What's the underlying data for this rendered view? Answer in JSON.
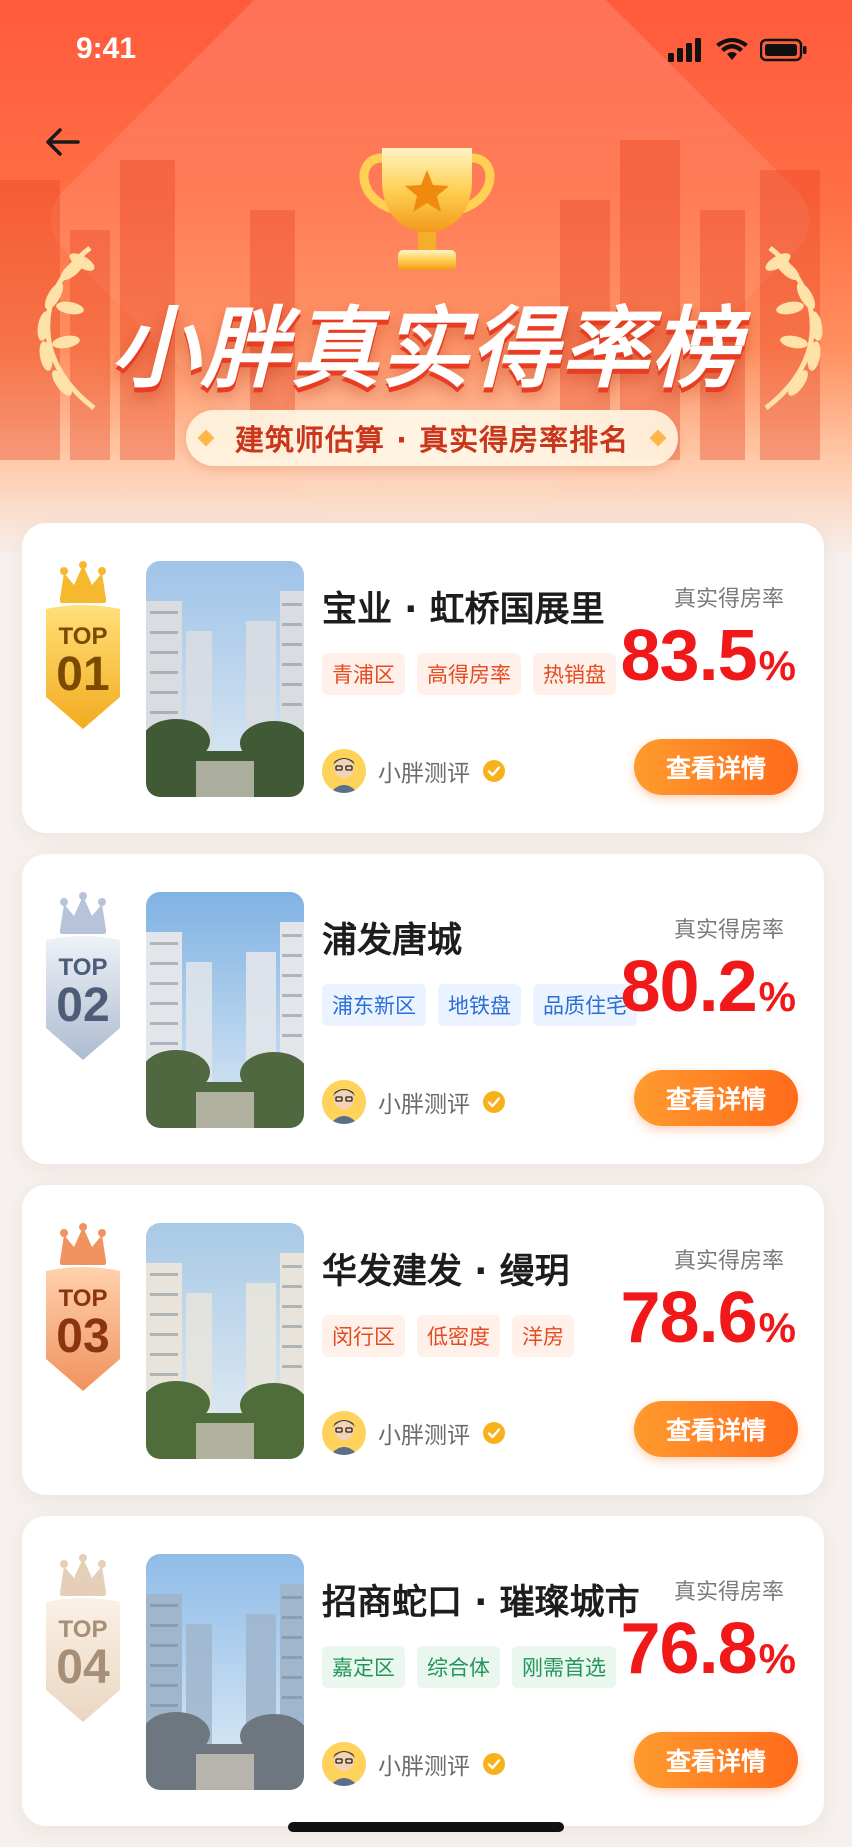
{
  "status_bar": {
    "time": "9:41"
  },
  "header": {
    "title": "小胖真实得率榜",
    "subtitle": "建筑师估算 · 真实得房率排名"
  },
  "list": [
    {
      "rank_label": "TOP",
      "rank": "01",
      "badge_color": "gold",
      "name": "宝业 · 虹桥国展里",
      "tags": [
        "青浦区",
        "高得房率",
        "热销盘"
      ],
      "tag_style": "orange",
      "author": "小胖测评",
      "rate_label": "真实得房率",
      "rate": "83.5",
      "rate_unit": "%",
      "button": "查看详情"
    },
    {
      "rank_label": "TOP",
      "rank": "02",
      "badge_color": "silver",
      "name": "浦发唐城",
      "tags": [
        "浦东新区",
        "地铁盘",
        "品质住宅"
      ],
      "tag_style": "blue",
      "author": "小胖测评",
      "rate_label": "真实得房率",
      "rate": "80.2",
      "rate_unit": "%",
      "button": "查看详情"
    },
    {
      "rank_label": "TOP",
      "rank": "03",
      "badge_color": "bronze",
      "name": "华发建发 · 缦玥",
      "tags": [
        "闵行区",
        "低密度",
        "洋房"
      ],
      "tag_style": "orange",
      "author": "小胖测评",
      "rate_label": "真实得房率",
      "rate": "78.6",
      "rate_unit": "%",
      "button": "查看详情"
    },
    {
      "rank_label": "TOP",
      "rank": "04",
      "badge_color": "beige",
      "name": "招商蛇口 · 璀璨城市",
      "tags": [
        "嘉定区",
        "综合体",
        "刚需首选"
      ],
      "tag_style": "green",
      "author": "小胖测评",
      "rate_label": "真实得房率",
      "rate": "76.8",
      "rate_unit": "%",
      "button": "查看详情"
    }
  ],
  "colors": {
    "accent": "#ff6a1a",
    "rate": "#f01818",
    "gold": "#f5b82e",
    "silver": "#9fadc4",
    "bronze": "#f0935e",
    "beige": "#e6cfb8"
  },
  "icons": [
    "back-arrow-icon",
    "signal-icon",
    "wifi-icon",
    "battery-icon",
    "trophy-icon",
    "laurel-icon",
    "crown-icon",
    "verified-icon"
  ]
}
